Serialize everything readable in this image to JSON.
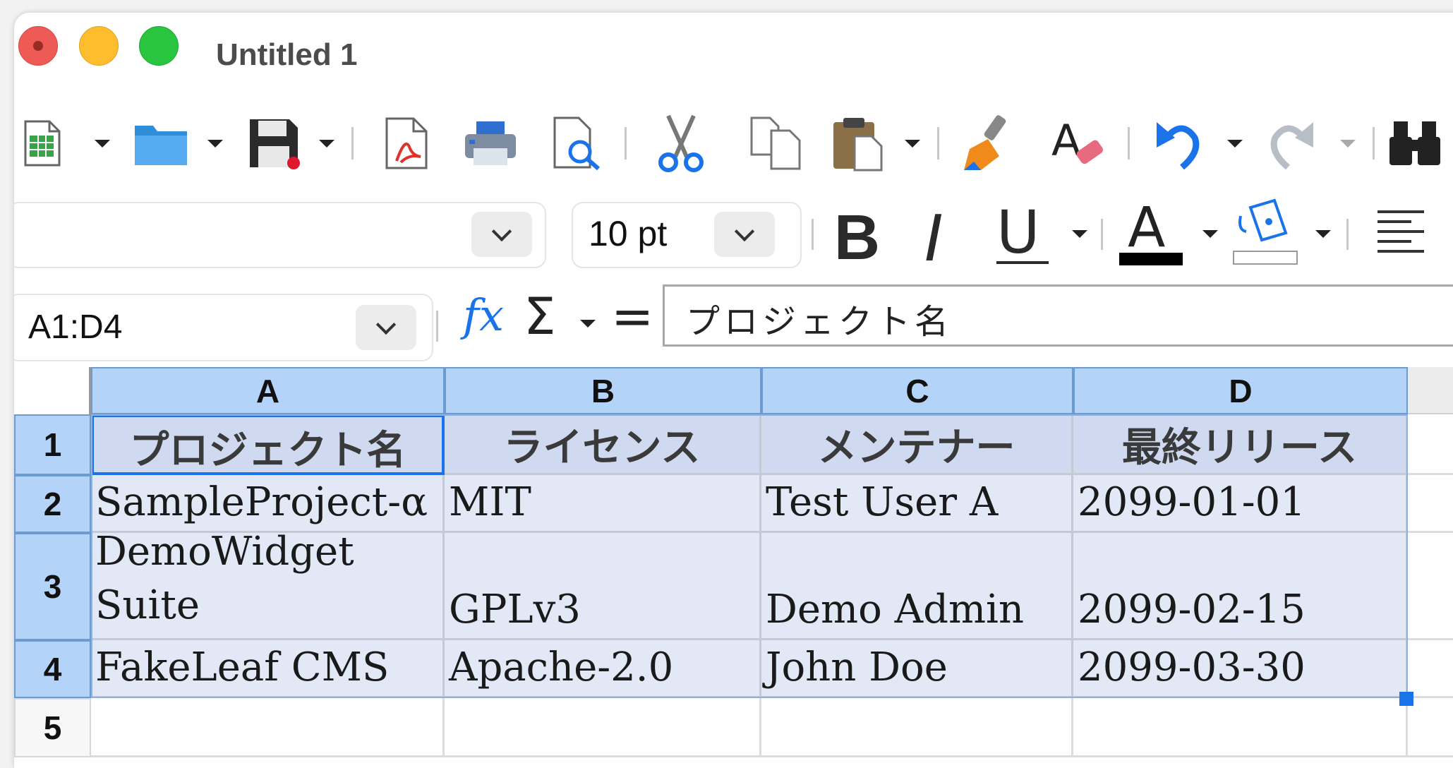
{
  "window": {
    "title": "Untitled 1"
  },
  "toolbar": {
    "icons": [
      "new-spreadsheet-icon",
      "open-folder-icon",
      "save-icon",
      "export-pdf-icon",
      "print-icon",
      "print-preview-icon",
      "cut-icon",
      "copy-icon",
      "paste-icon",
      "clone-formatting-icon",
      "clear-formatting-icon",
      "undo-icon",
      "redo-icon",
      "find-icon"
    ]
  },
  "format": {
    "font_name": "",
    "font_size": "10 pt",
    "bold_label": "B",
    "italic_label": "I",
    "underline_label": "U",
    "font_color_label": "A",
    "font_color": "#000000"
  },
  "formula_bar": {
    "name_box": "A1:D4",
    "fx_label": "fx",
    "sum_label": "Σ",
    "equals_label": "=",
    "content": "プロジェクト名"
  },
  "grid": {
    "columns": [
      "A",
      "B",
      "C",
      "D"
    ],
    "rows": [
      "1",
      "2",
      "3",
      "4",
      "5"
    ],
    "header_row": [
      "プロジェクト名",
      "ライセンス",
      "メンテナー",
      "最終リリース"
    ],
    "data": [
      [
        "SampleProject-α",
        "MIT",
        "Test User A",
        "2099-01-01"
      ],
      [
        "DemoWidget Suite",
        "GPLv3",
        "Demo Admin",
        "2099-02-15"
      ],
      [
        "FakeLeaf CMS",
        "Apache-2.0",
        "John Doe",
        "2099-03-30"
      ]
    ]
  },
  "colors": {
    "selection_header": "#b3d3f8",
    "selection_cell": "#e2e8f6",
    "header_cell": "#cfdaf1",
    "accent": "#1a73e8"
  }
}
